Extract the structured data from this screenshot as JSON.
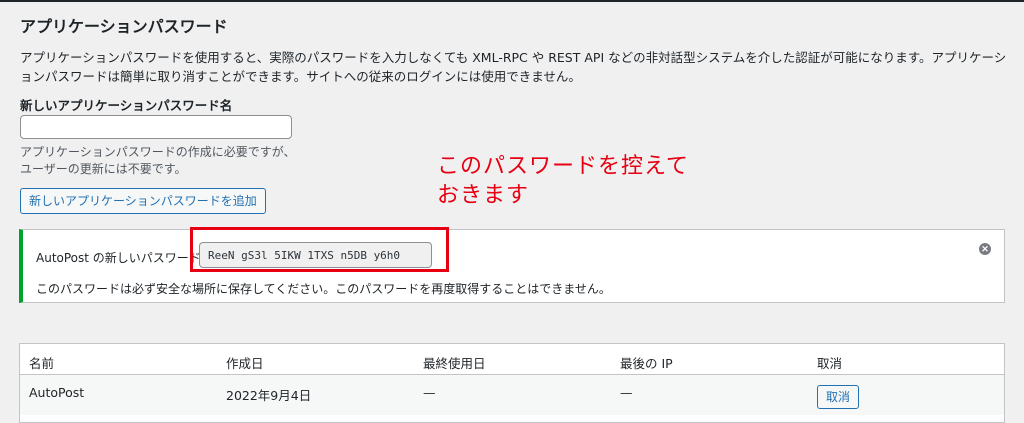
{
  "section": {
    "title": "アプリケーションパスワード",
    "description": "アプリケーションパスワードを使用すると、実際のパスワードを入力しなくても XML-RPC や REST API などの非対話型システムを介した認証が可能になります。アプリケーションパスワードは簡単に取り消すことができます。サイトへの従来のログインには使用できません。"
  },
  "new_password_form": {
    "label": "新しいアプリケーションパスワード名",
    "input_value": "",
    "help_line1": "アプリケーションパスワードの作成に必要ですが、",
    "help_line2": "ユーザーの更新には不要です。",
    "add_button_label": "新しいアプリケーションパスワードを追加"
  },
  "annotation": {
    "line1": "このパスワードを控えて",
    "line2": "おきます",
    "color": "#e60012"
  },
  "notice": {
    "label": "AutoPost の新しいパスワード:",
    "password": "ReeN gS3l 5IKW 1TXS n5DB y6h0",
    "message": "このパスワードは必ず安全な場所に保存してください。このパスワードを再度取得することはできません。",
    "dismiss_icon": "circle-x-icon",
    "accent_color": "#00a32a"
  },
  "table": {
    "headers": [
      "名前",
      "作成日",
      "最終使用日",
      "最後の IP",
      "取消"
    ],
    "rows": [
      {
        "name": "AutoPost",
        "created": "2022年9月4日",
        "last_used": "—",
        "last_ip": "—",
        "revoke_label": "取消"
      }
    ]
  }
}
